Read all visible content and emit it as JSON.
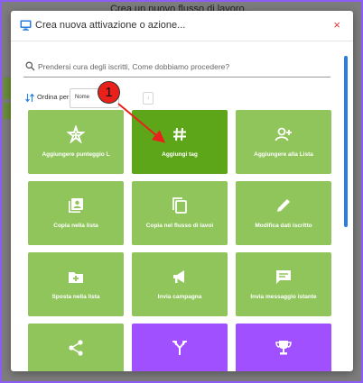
{
  "background": {
    "title": "Crea un nuovo flusso di lavoro..."
  },
  "modal": {
    "title": "Crea nuova attivazione o azione...",
    "close_label": "×",
    "search": {
      "placeholder": "Prendersi cura degli iscritti, Come dobbiamo procedere?"
    },
    "sort": {
      "label": "Ordina per",
      "selected": "Nome",
      "direction": "↓"
    },
    "cards": [
      {
        "label": "Aggiungere punteggio L",
        "icon": "star-plus-icon",
        "color": "#8fc55b"
      },
      {
        "label": "Aggiungi tag",
        "icon": "hashtag-icon",
        "color": "#5ea619"
      },
      {
        "label": "Aggiungere alla Lista",
        "icon": "person-add-icon",
        "color": "#8fc55b"
      },
      {
        "label": "Copia nella lista",
        "icon": "contact-list-icon",
        "color": "#8fc55b"
      },
      {
        "label": "Copia nel flusso di lavoi",
        "icon": "copy-icon",
        "color": "#8fc55b"
      },
      {
        "label": "Modifica dati iscritto",
        "icon": "pencil-icon",
        "color": "#8fc55b"
      },
      {
        "label": "Sposta nella lista",
        "icon": "folder-plus-icon",
        "color": "#8fc55b"
      },
      {
        "label": "Invia campagna",
        "icon": "megaphone-icon",
        "color": "#8fc55b"
      },
      {
        "label": "Invia messaggio istante",
        "icon": "chat-icon",
        "color": "#8fc55b"
      },
      {
        "label": "",
        "icon": "share-icon",
        "color": "#8fc55b"
      },
      {
        "label": "",
        "icon": "split-icon",
        "color": "#a150ff"
      },
      {
        "label": "",
        "icon": "trophy-icon",
        "color": "#a150ff"
      }
    ]
  },
  "annotation": {
    "number": "1"
  }
}
